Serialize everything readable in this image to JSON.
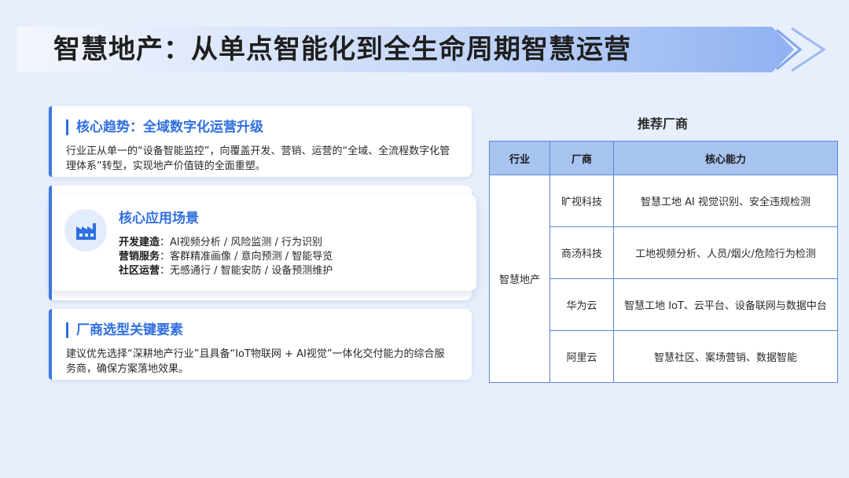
{
  "page": {
    "title": "智慧地产：从单点智能化到全生命周期智慧运营"
  },
  "cards": {
    "trend": {
      "heading": "核心趋势：全域数字化运营升级",
      "body": "行业正从单一的“设备智能监控”，向覆盖开发、营销、运营的“全域、全流程数字化管理体系”转型，实现地产价值链的全面重塑。"
    },
    "scenarios": {
      "icon": "factory-icon",
      "heading": "核心应用场景",
      "items": [
        {
          "label": "开发建造",
          "text": "：AI视频分析 / 风险监测 / 行为识别"
        },
        {
          "label": "营销服务",
          "text": "：客群精准画像 / 意向预测 / 智能导览"
        },
        {
          "label": "社区运营",
          "text": "：无感通行 / 智能安防 / 设备预测维护"
        }
      ]
    },
    "selection": {
      "heading": "厂商选型关键要素",
      "body": "建议优先选择“深耕地产行业”且具备“IoT物联网 + AI视觉”一体化交付能力的综合服务商，确保方案落地效果。"
    }
  },
  "vendors": {
    "title": "推荐厂商",
    "headers": [
      "行业",
      "厂商",
      "核心能力"
    ],
    "industry": "智慧地产",
    "rows": [
      {
        "vendor": "旷视科技",
        "capability": "智慧工地 AI 视觉识别、安全违规检测"
      },
      {
        "vendor": "商汤科技",
        "capability": "工地视频分析、人员/烟火/危险行为检测"
      },
      {
        "vendor": "华为云",
        "capability": "智慧工地 IoT、云平台、设备联网与数据中台"
      },
      {
        "vendor": "阿里云",
        "capability": "智慧社区、案场营销、数据智能"
      }
    ]
  },
  "colors": {
    "accent": "#2f6fe0",
    "background": "#e8effc",
    "table_header": "#a7c3f0",
    "table_border": "#3d6fd6"
  }
}
